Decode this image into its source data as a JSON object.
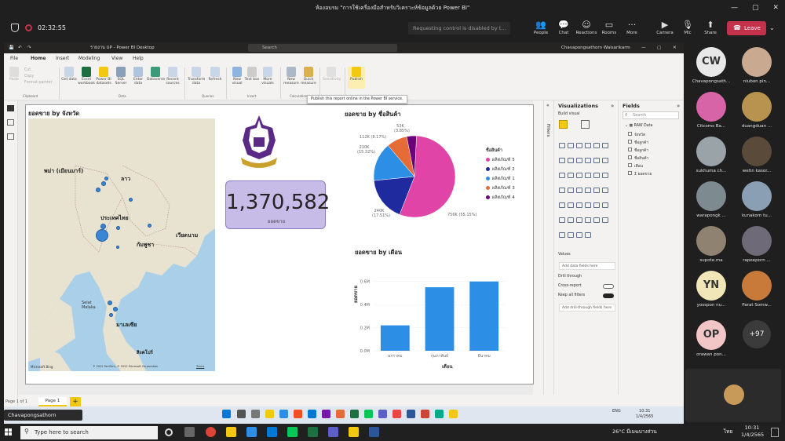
{
  "teams": {
    "window_title": "ห้องอบรม \"การใช้เครื่องมือสำหรับวิเคราะห์ข้อมูลด้วย Power BI\"",
    "timer": "02:32:55",
    "request_control": "Requesting control is disabled by t...",
    "toolbar": [
      {
        "label": "People",
        "icon": "people-icon"
      },
      {
        "label": "Chat",
        "icon": "chat-icon"
      },
      {
        "label": "Reactions",
        "icon": "reactions-icon"
      },
      {
        "label": "Rooms",
        "icon": "rooms-icon"
      },
      {
        "label": "More",
        "icon": "more-icon"
      },
      {
        "label": "Camera",
        "icon": "camera-icon"
      },
      {
        "label": "Mic",
        "icon": "mic-icon"
      },
      {
        "label": "Share",
        "icon": "share-icon"
      }
    ],
    "leave_label": "Leave",
    "presenter": "Chavapongsathorn Waisarikarm",
    "participants": [
      {
        "initials": "CW",
        "name": "Chavapongsath...",
        "color": "#e8e8e8"
      },
      {
        "initials": "",
        "name": "niubon pin...",
        "color": "#c9a98f"
      },
      {
        "initials": "",
        "name": "Citcoms Ba...",
        "color": "#d864a8"
      },
      {
        "initials": "",
        "name": "duangduan ...",
        "color": "#b8934f"
      },
      {
        "initials": "",
        "name": "sukhuma ch...",
        "color": "#9aa3a8"
      },
      {
        "initials": "",
        "name": "wetin kasor...",
        "color": "#5a4a3a"
      },
      {
        "initials": "",
        "name": "warapongk ...",
        "color": "#7d8a8f"
      },
      {
        "initials": "",
        "name": "kunakorn tu...",
        "color": "#8a9fb4"
      },
      {
        "initials": "",
        "name": "supote.ma",
        "color": "#8f8270"
      },
      {
        "initials": "",
        "name": "rapeeporn ...",
        "color": "#6e6a78"
      },
      {
        "initials": "YN",
        "name": "yosspon nu...",
        "color": "#f0e6b8"
      },
      {
        "initials": "",
        "name": "Parat Somw...",
        "color": "#c87a3a"
      },
      {
        "initials": "OP",
        "name": "orawan pon...",
        "color": "#f2c6c6"
      }
    ],
    "more_count": "+97"
  },
  "pbi": {
    "title": "รายงาน UP - Power BI Desktop",
    "search": "Search",
    "user": "Chavapongsathorn Waisarikarm",
    "menu": [
      "File",
      "Home",
      "Insert",
      "Modeling",
      "View",
      "Help"
    ],
    "ribbon": {
      "clipboard": [
        "Paste",
        "Cut",
        "Copy",
        "Format painter"
      ],
      "data": [
        "Get data",
        "Excel workbook",
        "Power BI datasets",
        "SQL Server",
        "Enter data",
        "Dataverse",
        "Recent sources"
      ],
      "queries": [
        "Transform data",
        "Refresh"
      ],
      "insert": [
        "New visual",
        "Text box",
        "More visuals"
      ],
      "calculations": [
        "New measure",
        "Quick measure"
      ],
      "sensitivity": "Sensitivity",
      "publish": "Publish",
      "groups": [
        "Clipboard",
        "Data",
        "Queries",
        "Insert",
        "Calculations",
        "Sensitivity",
        "Share"
      ]
    },
    "tooltip": "Publish this report online in the Power BI service.",
    "map_visual": {
      "title": "ยอดขาย by จังหวัด",
      "labels": [
        "พม่า (เมียนมาร์)",
        "ลาว",
        "ประเทศไทย",
        "กัมพูชา",
        "เวียดนาม",
        "มาเลเซีย",
        "สิงคโปร์"
      ],
      "small_labels": [
        "Selat Melaka"
      ],
      "attribution": "© 2022 TomTom, © 2022 Microsoft Corporation",
      "terms": "Terms",
      "brand": "Microsoft Bing"
    },
    "card": {
      "value": "1,370,582",
      "label": "ยอดขาย"
    },
    "pie_visual": {
      "title": "ยอดขาย by ชื่อสินค้า",
      "legend_title": "ชื่อสินค้า",
      "data_labels": [
        "756K (55.15%)",
        "240K (17.51%)",
        "210K (15.32%)",
        "112K (8.17%)",
        "53K (3.85%)"
      ]
    },
    "bar_visual": {
      "title": "ยอดขาย by เดือน",
      "xlabel": "เดือน",
      "ylabel": "ยอดขาย",
      "ticks": [
        "0.0M",
        "0.2M",
        "0.4M",
        "0.6M"
      ]
    },
    "filters_label": "Filters",
    "viz_pane": {
      "title": "Visualizations",
      "build": "Build visual",
      "values": "Values",
      "add_data": "Add data fields here",
      "drill": "Drill through",
      "cross": "Cross-report",
      "keep": "Keep all filters",
      "add_drill": "Add drill-through fields here"
    },
    "fields_pane": {
      "title": "Fields",
      "search": "Search",
      "table": "RAW Data",
      "fields": [
        "จังหวัด",
        "ชื่อลูกค้า",
        "ชื่อลูกค้า",
        "ชื่อสินค้า",
        "เดือน",
        "Σ ยอดขาย"
      ]
    },
    "page_tab": "Page 1",
    "status": "Page 1 of 1"
  },
  "chart_data": [
    {
      "type": "pie",
      "title": "ยอดขาย by ชื่อสินค้า",
      "categories": [
        "ผลิตภัณฑ์ 5",
        "ผลิตภัณฑ์ 2",
        "ผลิตภัณฑ์ 1",
        "ผลิตภัณฑ์ 3",
        "ผลิตภัณฑ์ 4"
      ],
      "values": [
        756000,
        240000,
        210000,
        112000,
        53000
      ],
      "colors": [
        "#e044a7",
        "#1f2a9e",
        "#2d8ee6",
        "#e66c37",
        "#6b007b"
      ],
      "legend_title": "ชื่อสินค้า"
    },
    {
      "type": "bar",
      "title": "ยอดขาย by เดือน",
      "categories": [
        "มกราคม",
        "กุมภาพันธ์",
        "มีนาคม"
      ],
      "values": [
        0.22,
        0.55,
        0.6
      ],
      "ylim": [
        0,
        0.7
      ],
      "xlabel": "เดือน",
      "ylabel": "ยอดขาย",
      "color": "#2d8ee6"
    }
  ],
  "inner_taskbar": {
    "lang": "ENG",
    "time": "10:31",
    "date": "1/4/2565"
  },
  "taskbar": {
    "search": "Type here to search",
    "weather": "26°C มีเมฆบางส่วน",
    "lang": "ไทย",
    "time": "10:31",
    "date": "1/4/2565"
  }
}
